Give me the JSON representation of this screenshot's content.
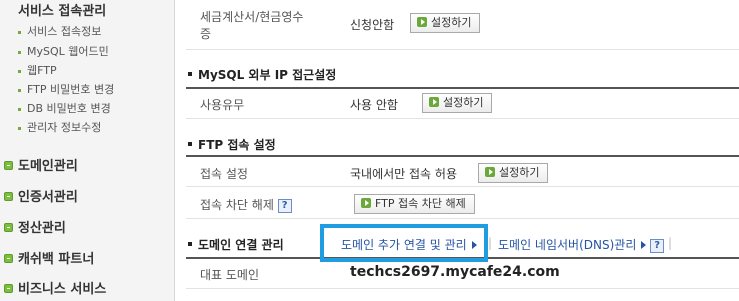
{
  "sidebar": {
    "section_title": "서비스 접속관리",
    "sub_items": [
      {
        "label": "서비스 접속정보"
      },
      {
        "label": "MySQL 웹어드민"
      },
      {
        "label": "웹FTP"
      },
      {
        "label": "FTP 비밀번호 변경"
      },
      {
        "label": "DB 비밀번호 변경"
      },
      {
        "label": "관리자 정보수정"
      }
    ],
    "main_items": [
      {
        "label": "도메인관리"
      },
      {
        "label": "인증서관리"
      },
      {
        "label": "정산관리"
      },
      {
        "label": "캐쉬백 파트너"
      },
      {
        "label": "비즈니스 서비스"
      }
    ]
  },
  "main": {
    "tax_row": {
      "label_line1": "세금계산서/현금영수",
      "label_line2": "증",
      "value": "신청안함",
      "button": "설정하기"
    },
    "mysql": {
      "title": "MySQL 외부 IP 접근설정",
      "row": {
        "label": "사용유무",
        "value": "사용 안함",
        "button": "설정하기"
      }
    },
    "ftp": {
      "title": "FTP 접속 설정",
      "rows": [
        {
          "label": "접속 설정",
          "value": "국내에서만 접속 허용",
          "button": "설정하기"
        },
        {
          "label": "접속 차단 해제",
          "help": "?",
          "button": "FTP 접속 차단 해제"
        }
      ]
    },
    "domain": {
      "title": "도메인 연결 관리",
      "link_add": "도메인 추가 연결 및 관리",
      "link_ns": "도메인 네임서버(DNS)관리",
      "help": "?",
      "row": {
        "label": "대표 도메인",
        "value": "techcs2697.mycafe24.com"
      }
    }
  },
  "colors": {
    "highlight": "#1f9de0",
    "accent_green": "#6aa83a",
    "link": "#2554a5"
  }
}
